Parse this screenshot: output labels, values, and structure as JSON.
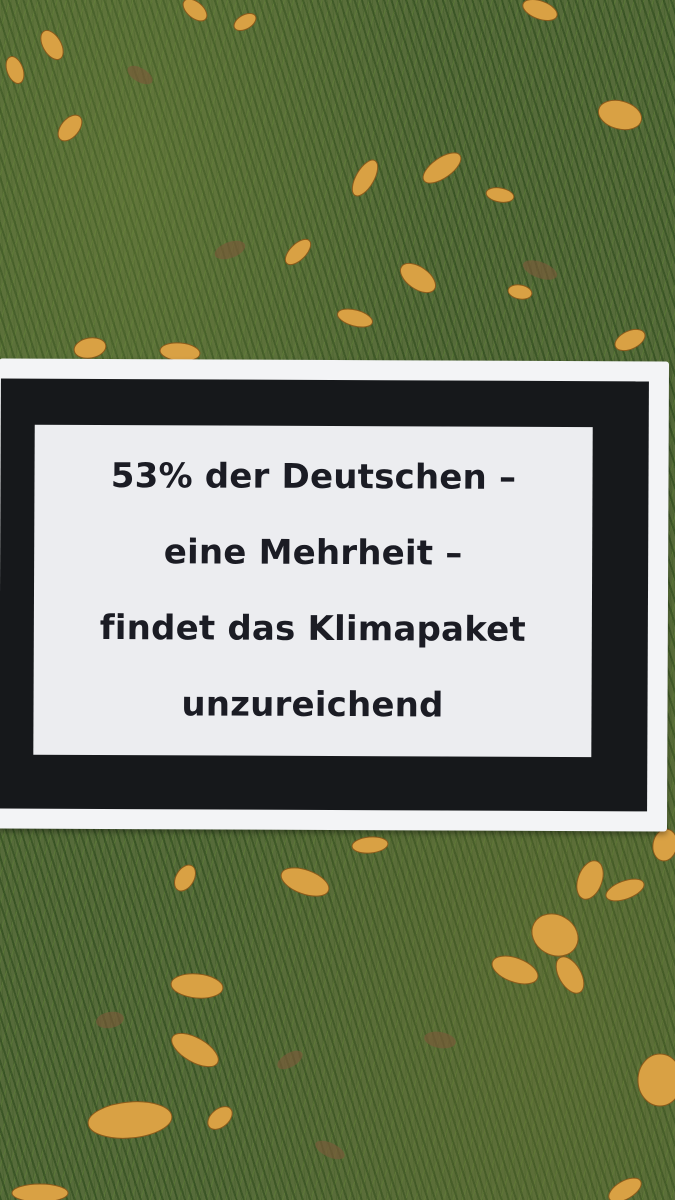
{
  "photo": {
    "subject": "protest-sign-on-lawn",
    "colors": {
      "grass": "#566b3a",
      "leaf": "#d9a144",
      "sign_board": "#f3f4f6",
      "sign_frame": "#16181b",
      "sign_panel": "#ecedf0",
      "text": "#1b1c24"
    }
  },
  "sign": {
    "lines": [
      "53% der Deutschen –",
      "eine Mehrheit –",
      "findet das Klimapaket",
      "unzureichend"
    ]
  }
}
